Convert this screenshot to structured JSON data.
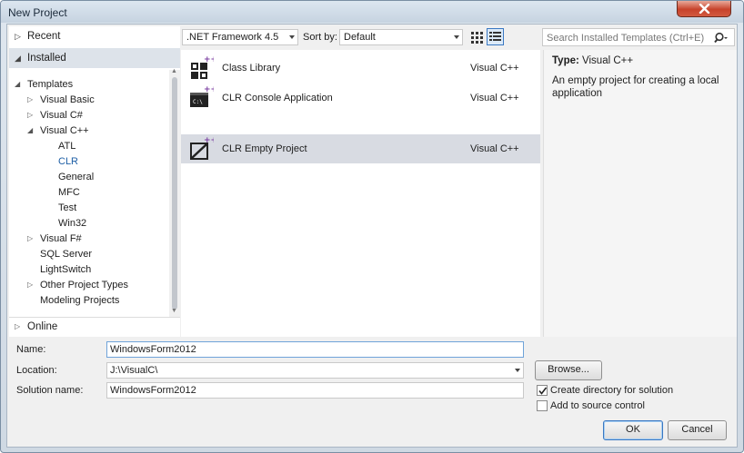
{
  "window": {
    "title": "New Project"
  },
  "tree": {
    "recent": "Recent",
    "installed": "Installed",
    "online": "Online",
    "items": [
      {
        "label": "Templates",
        "toggle": "◢",
        "indent": 0
      },
      {
        "label": "Visual Basic",
        "toggle": "▷",
        "indent": 1
      },
      {
        "label": "Visual C#",
        "toggle": "▷",
        "indent": 1
      },
      {
        "label": "Visual C++",
        "toggle": "◢",
        "indent": 1
      },
      {
        "label": "ATL",
        "toggle": "",
        "indent": 2
      },
      {
        "label": "CLR",
        "toggle": "",
        "indent": 2
      },
      {
        "label": "General",
        "toggle": "",
        "indent": 2
      },
      {
        "label": "MFC",
        "toggle": "",
        "indent": 2
      },
      {
        "label": "Test",
        "toggle": "",
        "indent": 2
      },
      {
        "label": "Win32",
        "toggle": "",
        "indent": 2
      },
      {
        "label": "Visual F#",
        "toggle": "▷",
        "indent": 1
      },
      {
        "label": "SQL Server",
        "toggle": "",
        "indent": 1
      },
      {
        "label": "LightSwitch",
        "toggle": "",
        "indent": 1
      },
      {
        "label": "Other Project Types",
        "toggle": "▷",
        "indent": 1
      },
      {
        "label": "Modeling Projects",
        "toggle": "",
        "indent": 1
      }
    ]
  },
  "toolbar": {
    "framework": ".NET Framework 4.5",
    "sort_label": "Sort by:",
    "sort_value": "Default",
    "search_placeholder": "Search Installed Templates (Ctrl+E)"
  },
  "templates": [
    {
      "name": "Class Library",
      "language": "Visual C++",
      "icon": "class-library-icon"
    },
    {
      "name": "CLR Console Application",
      "language": "Visual C++",
      "icon": "console-app-icon"
    },
    {
      "name": "CLR Empty Project",
      "language": "Visual C++",
      "icon": "empty-project-icon"
    }
  ],
  "details": {
    "type_label": "Type:",
    "type_value": "Visual C++",
    "description": "An empty project for creating a local application"
  },
  "form": {
    "name_label": "Name:",
    "name_value": "WindowsForm2012",
    "location_label": "Location:",
    "location_value": "J:\\VisualC\\",
    "solution_label": "Solution name:",
    "solution_value": "WindowsForm2012",
    "browse_label": "Browse...",
    "create_dir_label": "Create directory for solution",
    "create_dir_checked": true,
    "source_control_label": "Add to source control",
    "source_control_checked": false,
    "ok_label": "OK",
    "cancel_label": "Cancel"
  },
  "colors": {
    "selection": "#d8dbe2",
    "accent": "#3a78c2",
    "close_red": "#c7432b"
  }
}
